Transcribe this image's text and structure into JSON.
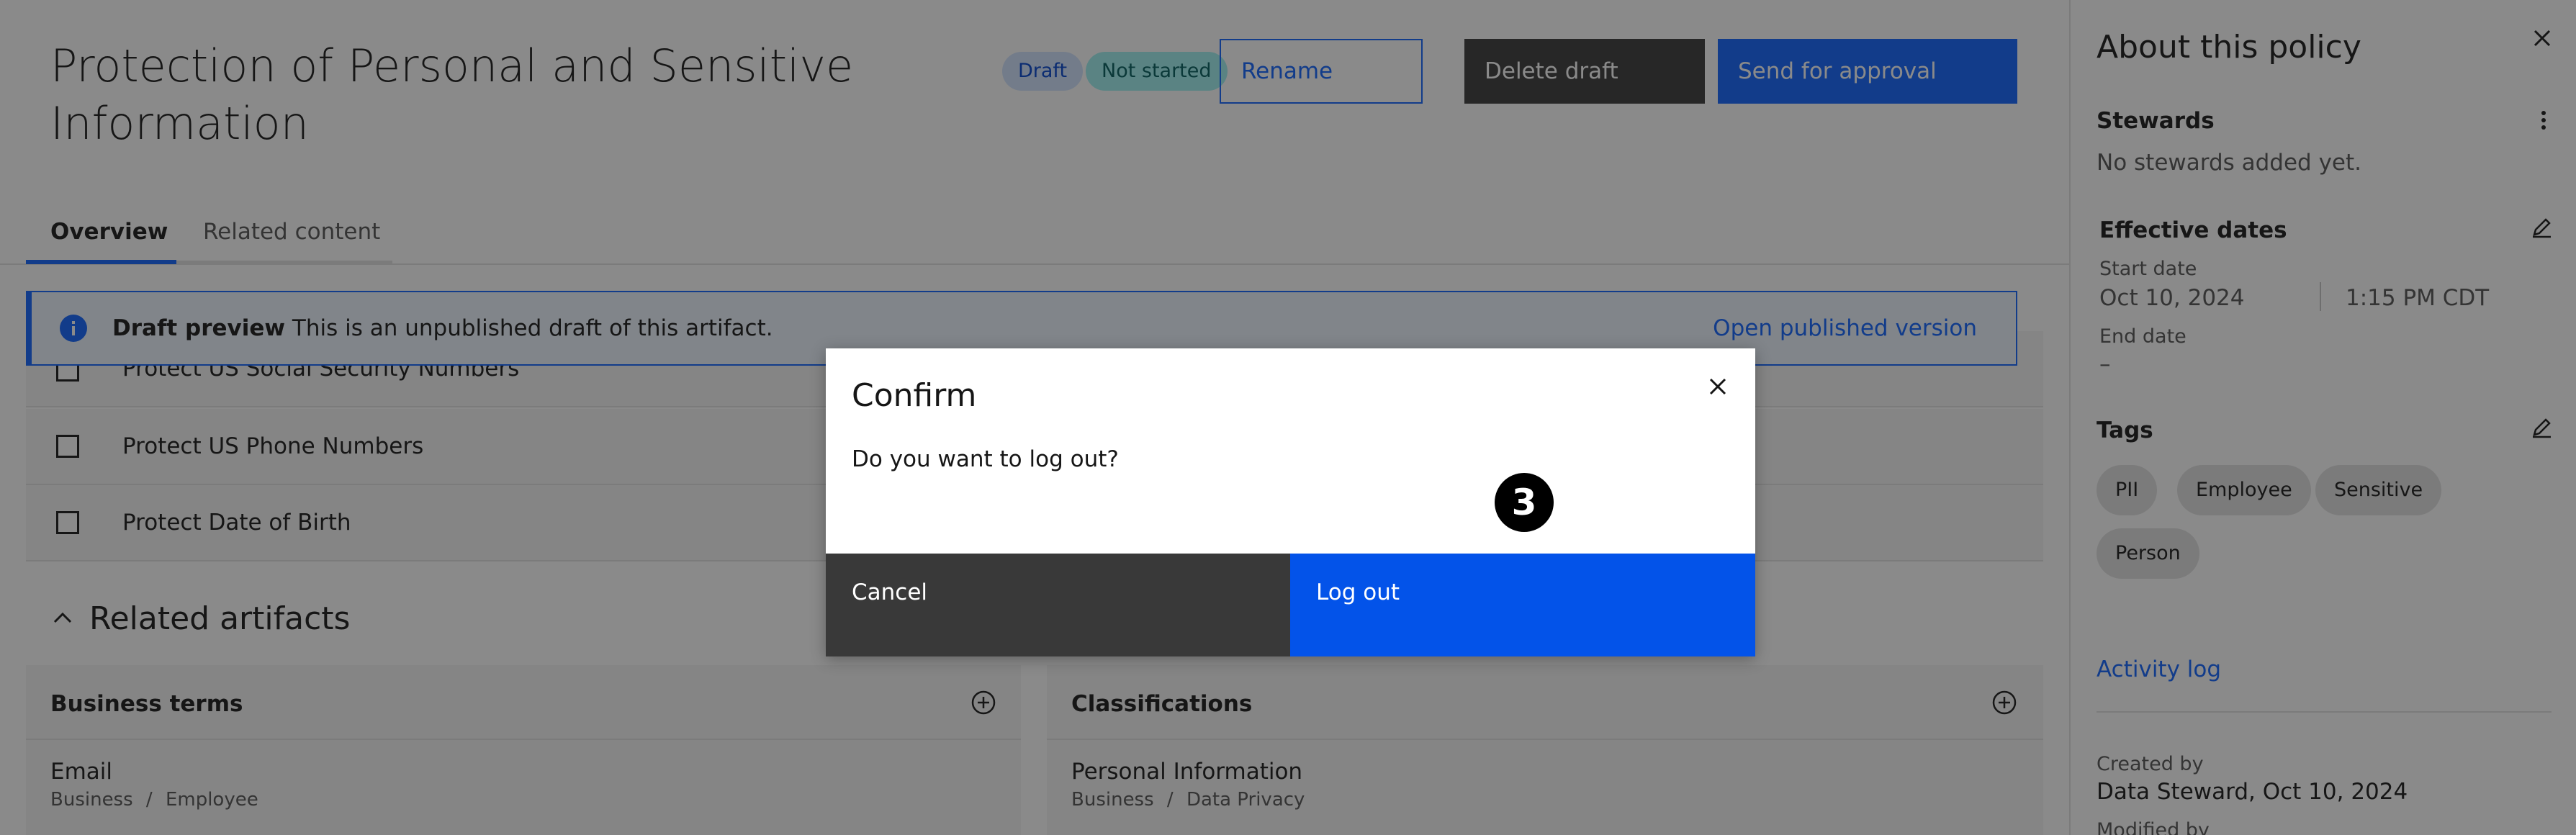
{
  "page": {
    "title": "Protection of Personal and Sensitive Information",
    "badges": {
      "draft": "Draft",
      "status": "Not started"
    },
    "buttons": {
      "rename": "Rename",
      "delete_draft": "Delete draft",
      "send_for_approval": "Send for approval"
    },
    "tabs": [
      {
        "label": "Overview",
        "active": true
      },
      {
        "label": "Related content",
        "active": false
      }
    ],
    "banner": {
      "icon": "info-icon",
      "bold": "Draft preview",
      "text": "This is an unpublished draft of this artifact.",
      "link": "Open published version"
    },
    "rules": [
      {
        "label": "Protect US Social Security Numbers"
      },
      {
        "label": "Protect US Phone Numbers"
      },
      {
        "label": "Protect Date of Birth"
      }
    ],
    "related": {
      "heading": "Related artifacts",
      "business_terms": {
        "title": "Business terms",
        "item": "Email",
        "path_a": "Business",
        "path_b": "Employee"
      },
      "classifications": {
        "title": "Classifications",
        "item": "Personal Information",
        "path_a": "Business",
        "path_b": "Data Privacy"
      }
    }
  },
  "panel": {
    "title": "About this policy",
    "stewards_label": "Stewards",
    "stewards_value": "No stewards added yet.",
    "effective_label": "Effective dates",
    "start_label": "Start date",
    "start_date": "Oct 10, 2024",
    "start_time": "1:15 PM CDT",
    "end_label": "End date",
    "end_value": "–",
    "tags_label": "Tags",
    "tags": [
      "PII",
      "Employee",
      "Sensitive",
      "Person"
    ],
    "activity_log": "Activity log",
    "created_label": "Created by",
    "created_value": "Data Steward, Oct 10, 2024",
    "modified_label": "Modified by"
  },
  "modal": {
    "title": "Confirm",
    "body": "Do you want to log out?",
    "cancel": "Cancel",
    "confirm": "Log out",
    "step": "3"
  },
  "colors": {
    "primary": "#0f62fe",
    "dark_button": "#393939",
    "modal_primary": "#0353e9",
    "overlay": "rgba(22,22,22,0.5)"
  }
}
